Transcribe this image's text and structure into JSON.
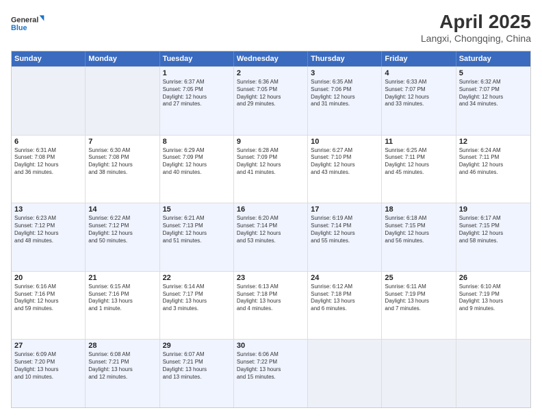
{
  "logo": {
    "text_general": "General",
    "text_blue": "Blue"
  },
  "title": "April 2025",
  "subtitle": "Langxi, Chongqing, China",
  "header_days": [
    "Sunday",
    "Monday",
    "Tuesday",
    "Wednesday",
    "Thursday",
    "Friday",
    "Saturday"
  ],
  "rows": [
    [
      {
        "day": "",
        "info": "",
        "empty": true
      },
      {
        "day": "",
        "info": "",
        "empty": true
      },
      {
        "day": "1",
        "info": "Sunrise: 6:37 AM\nSunset: 7:05 PM\nDaylight: 12 hours\nand 27 minutes."
      },
      {
        "day": "2",
        "info": "Sunrise: 6:36 AM\nSunset: 7:05 PM\nDaylight: 12 hours\nand 29 minutes."
      },
      {
        "day": "3",
        "info": "Sunrise: 6:35 AM\nSunset: 7:06 PM\nDaylight: 12 hours\nand 31 minutes."
      },
      {
        "day": "4",
        "info": "Sunrise: 6:33 AM\nSunset: 7:07 PM\nDaylight: 12 hours\nand 33 minutes."
      },
      {
        "day": "5",
        "info": "Sunrise: 6:32 AM\nSunset: 7:07 PM\nDaylight: 12 hours\nand 34 minutes."
      }
    ],
    [
      {
        "day": "6",
        "info": "Sunrise: 6:31 AM\nSunset: 7:08 PM\nDaylight: 12 hours\nand 36 minutes."
      },
      {
        "day": "7",
        "info": "Sunrise: 6:30 AM\nSunset: 7:08 PM\nDaylight: 12 hours\nand 38 minutes."
      },
      {
        "day": "8",
        "info": "Sunrise: 6:29 AM\nSunset: 7:09 PM\nDaylight: 12 hours\nand 40 minutes."
      },
      {
        "day": "9",
        "info": "Sunrise: 6:28 AM\nSunset: 7:09 PM\nDaylight: 12 hours\nand 41 minutes."
      },
      {
        "day": "10",
        "info": "Sunrise: 6:27 AM\nSunset: 7:10 PM\nDaylight: 12 hours\nand 43 minutes."
      },
      {
        "day": "11",
        "info": "Sunrise: 6:25 AM\nSunset: 7:11 PM\nDaylight: 12 hours\nand 45 minutes."
      },
      {
        "day": "12",
        "info": "Sunrise: 6:24 AM\nSunset: 7:11 PM\nDaylight: 12 hours\nand 46 minutes."
      }
    ],
    [
      {
        "day": "13",
        "info": "Sunrise: 6:23 AM\nSunset: 7:12 PM\nDaylight: 12 hours\nand 48 minutes."
      },
      {
        "day": "14",
        "info": "Sunrise: 6:22 AM\nSunset: 7:12 PM\nDaylight: 12 hours\nand 50 minutes."
      },
      {
        "day": "15",
        "info": "Sunrise: 6:21 AM\nSunset: 7:13 PM\nDaylight: 12 hours\nand 51 minutes."
      },
      {
        "day": "16",
        "info": "Sunrise: 6:20 AM\nSunset: 7:14 PM\nDaylight: 12 hours\nand 53 minutes."
      },
      {
        "day": "17",
        "info": "Sunrise: 6:19 AM\nSunset: 7:14 PM\nDaylight: 12 hours\nand 55 minutes."
      },
      {
        "day": "18",
        "info": "Sunrise: 6:18 AM\nSunset: 7:15 PM\nDaylight: 12 hours\nand 56 minutes."
      },
      {
        "day": "19",
        "info": "Sunrise: 6:17 AM\nSunset: 7:15 PM\nDaylight: 12 hours\nand 58 minutes."
      }
    ],
    [
      {
        "day": "20",
        "info": "Sunrise: 6:16 AM\nSunset: 7:16 PM\nDaylight: 12 hours\nand 59 minutes."
      },
      {
        "day": "21",
        "info": "Sunrise: 6:15 AM\nSunset: 7:16 PM\nDaylight: 13 hours\nand 1 minute."
      },
      {
        "day": "22",
        "info": "Sunrise: 6:14 AM\nSunset: 7:17 PM\nDaylight: 13 hours\nand 3 minutes."
      },
      {
        "day": "23",
        "info": "Sunrise: 6:13 AM\nSunset: 7:18 PM\nDaylight: 13 hours\nand 4 minutes."
      },
      {
        "day": "24",
        "info": "Sunrise: 6:12 AM\nSunset: 7:18 PM\nDaylight: 13 hours\nand 6 minutes."
      },
      {
        "day": "25",
        "info": "Sunrise: 6:11 AM\nSunset: 7:19 PM\nDaylight: 13 hours\nand 7 minutes."
      },
      {
        "day": "26",
        "info": "Sunrise: 6:10 AM\nSunset: 7:19 PM\nDaylight: 13 hours\nand 9 minutes."
      }
    ],
    [
      {
        "day": "27",
        "info": "Sunrise: 6:09 AM\nSunset: 7:20 PM\nDaylight: 13 hours\nand 10 minutes."
      },
      {
        "day": "28",
        "info": "Sunrise: 6:08 AM\nSunset: 7:21 PM\nDaylight: 13 hours\nand 12 minutes."
      },
      {
        "day": "29",
        "info": "Sunrise: 6:07 AM\nSunset: 7:21 PM\nDaylight: 13 hours\nand 13 minutes."
      },
      {
        "day": "30",
        "info": "Sunrise: 6:06 AM\nSunset: 7:22 PM\nDaylight: 13 hours\nand 15 minutes."
      },
      {
        "day": "",
        "info": "",
        "empty": true
      },
      {
        "day": "",
        "info": "",
        "empty": true
      },
      {
        "day": "",
        "info": "",
        "empty": true
      }
    ]
  ]
}
